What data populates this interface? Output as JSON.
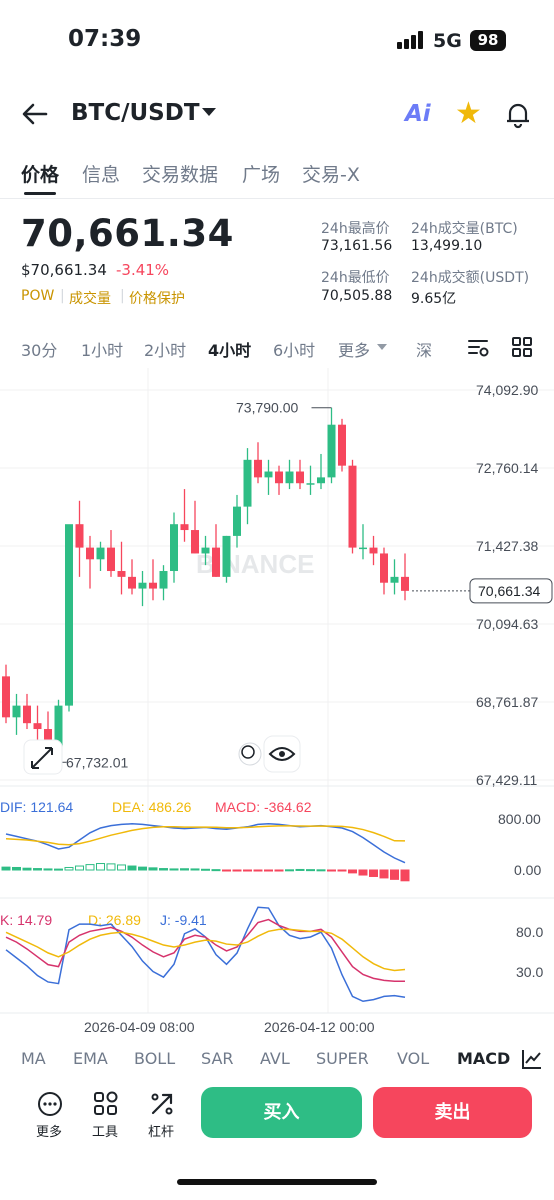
{
  "status_bar": {
    "time": "07:39",
    "network": "5G",
    "battery": "98"
  },
  "header": {
    "pair": "BTC/USDT",
    "ai_label": "Ai"
  },
  "tabs": [
    {
      "label": "价格",
      "active": true
    },
    {
      "label": "信息",
      "active": false
    },
    {
      "label": "交易数据",
      "active": false
    },
    {
      "label": "广场",
      "active": false
    },
    {
      "label": "交易-X",
      "active": false
    }
  ],
  "price": {
    "last": "70,661.34",
    "usd": "$70,661.34",
    "change_pct": "-3.41%",
    "tags": [
      "POW",
      "成交量",
      "价格保护"
    ]
  },
  "stats": {
    "high_label": "24h最高价",
    "high": "73,161.56",
    "vol_btc_label": "24h成交量(BTC)",
    "vol_btc": "13,499.10",
    "low_label": "24h最低价",
    "low": "70,505.88",
    "vol_usdt_label": "24h成交额(USDT)",
    "vol_usdt": "9.65亿"
  },
  "intervals": [
    {
      "label": "30分",
      "active": false
    },
    {
      "label": "1小时",
      "active": false
    },
    {
      "label": "2小时",
      "active": false
    },
    {
      "label": "4小时",
      "active": true
    },
    {
      "label": "6小时",
      "active": false
    },
    {
      "label": "更多",
      "active": false
    },
    {
      "label": "深",
      "active": false
    }
  ],
  "colors": {
    "up": "#2ebd85",
    "down": "#f6465d",
    "accent": "#f0b90b",
    "dif": "#3b6fd8",
    "dea": "#f0b90b",
    "k": "#d6336c",
    "d": "#f0b90b",
    "j": "#3b6fd8"
  },
  "chart_data": {
    "type": "candlestick",
    "price_axis": [
      "74,092.90",
      "72,760.14",
      "71,427.38",
      "70,094.63",
      "68,761.87",
      "67,429.11"
    ],
    "ylim": [
      67429.11,
      74092.9
    ],
    "last_price_label": "70,661.34",
    "high_marker": "73,790.00",
    "low_marker": "67,732.01",
    "time_axis": [
      "2026-04-09 08:00",
      "2026-04-12 00:00"
    ],
    "watermark": "BINANCE",
    "candles": [
      [
        69200,
        69400,
        68400,
        68500
      ],
      [
        68500,
        68900,
        68200,
        68700
      ],
      [
        68700,
        68900,
        68300,
        68400
      ],
      [
        68400,
        68700,
        68100,
        68300
      ],
      [
        68300,
        68600,
        67900,
        68000
      ],
      [
        68000,
        68800,
        67732,
        68700
      ],
      [
        68700,
        71700,
        68600,
        71800
      ],
      [
        71800,
        72200,
        70900,
        71400
      ],
      [
        71400,
        71600,
        70700,
        71200
      ],
      [
        71200,
        71500,
        71000,
        71400
      ],
      [
        71400,
        71700,
        70900,
        71000
      ],
      [
        71000,
        71500,
        70600,
        70900
      ],
      [
        70900,
        71200,
        70600,
        70700
      ],
      [
        70700,
        71000,
        70400,
        70800
      ],
      [
        70800,
        71200,
        70500,
        70700
      ],
      [
        70700,
        71100,
        70500,
        71000
      ],
      [
        71000,
        72000,
        70800,
        71800
      ],
      [
        71800,
        72400,
        71500,
        71700
      ],
      [
        71700,
        72200,
        71300,
        71300
      ],
      [
        71300,
        71600,
        71100,
        71400
      ],
      [
        71400,
        71800,
        70900,
        70900
      ],
      [
        70900,
        71600,
        70800,
        71600
      ],
      [
        71600,
        72300,
        71400,
        72100
      ],
      [
        72100,
        73100,
        71800,
        72900
      ],
      [
        72900,
        73200,
        72500,
        72600
      ],
      [
        72600,
        72900,
        72300,
        72700
      ],
      [
        72700,
        72800,
        72300,
        72500
      ],
      [
        72500,
        72900,
        72400,
        72700
      ],
      [
        72700,
        72900,
        72400,
        72500
      ],
      [
        72500,
        72800,
        72300,
        72500
      ],
      [
        72500,
        73000,
        72400,
        72600
      ],
      [
        72600,
        73790,
        72500,
        73500
      ],
      [
        73500,
        73600,
        72700,
        72800
      ],
      [
        72800,
        72900,
        71300,
        71400
      ],
      [
        71400,
        71800,
        71200,
        71400
      ],
      [
        71400,
        71600,
        71100,
        71300
      ],
      [
        71300,
        71400,
        70600,
        70800
      ],
      [
        70800,
        71200,
        70600,
        70900
      ],
      [
        70900,
        71300,
        70500,
        70661
      ]
    ],
    "macd": {
      "dif": "121.64",
      "dea": "486.26",
      "macd": "-364.62",
      "axis": [
        "800.00",
        "0.00"
      ],
      "hist": [
        80,
        70,
        50,
        40,
        30,
        25,
        70,
        110,
        150,
        180,
        170,
        140,
        110,
        80,
        60,
        40,
        30,
        35,
        30,
        20,
        10,
        -10,
        -15,
        -20,
        -15,
        -10,
        -5,
        5,
        15,
        10,
        5,
        -5,
        -20,
        -80,
        -140,
        -180,
        -220,
        -260,
        -300
      ],
      "dif_line": [
        600,
        560,
        520,
        480,
        420,
        350,
        380,
        500,
        620,
        700,
        740,
        760,
        770,
        760,
        740,
        720,
        700,
        690,
        700,
        710,
        690,
        680,
        700,
        720,
        760,
        770,
        760,
        740,
        720,
        730,
        740,
        720,
        700,
        640,
        540,
        420,
        300,
        200,
        122
      ],
      "dea_line": [
        520,
        510,
        500,
        480,
        460,
        430,
        420,
        440,
        480,
        530,
        580,
        620,
        660,
        690,
        710,
        720,
        720,
        715,
        715,
        715,
        712,
        705,
        705,
        710,
        720,
        730,
        735,
        735,
        733,
        732,
        734,
        732,
        727,
        708,
        674,
        623,
        559,
        487,
        486
      ]
    },
    "kdj": {
      "k": "14.79",
      "d": "26.89",
      "j": "-9.41",
      "axis": [
        "80.0",
        "30.0"
      ],
      "k_line": [
        60,
        55,
        48,
        40,
        32,
        30,
        55,
        62,
        66,
        68,
        70,
        66,
        60,
        52,
        45,
        40,
        44,
        58,
        62,
        60,
        52,
        46,
        50,
        62,
        75,
        78,
        72,
        68,
        66,
        66,
        68,
        60,
        45,
        30,
        22,
        18,
        16,
        15,
        15
      ],
      "d_line": [
        65,
        60,
        55,
        50,
        44,
        40,
        45,
        52,
        58,
        62,
        64,
        65,
        63,
        60,
        56,
        52,
        50,
        52,
        55,
        57,
        56,
        53,
        52,
        55,
        61,
        66,
        68,
        68,
        67,
        66,
        66,
        64,
        58,
        49,
        40,
        33,
        28,
        26,
        27
      ],
      "j_line": [
        50,
        40,
        30,
        18,
        10,
        8,
        75,
        82,
        82,
        80,
        82,
        68,
        54,
        36,
        23,
        16,
        32,
        70,
        76,
        66,
        44,
        32,
        46,
        76,
        103,
        102,
        80,
        68,
        64,
        66,
        72,
        52,
        19,
        -8,
        -14,
        -12,
        -8,
        -7,
        -9
      ]
    }
  },
  "indicators": [
    {
      "label": "MA",
      "active": false
    },
    {
      "label": "EMA",
      "active": false
    },
    {
      "label": "BOLL",
      "active": false
    },
    {
      "label": "SAR",
      "active": false
    },
    {
      "label": "AVL",
      "active": false
    },
    {
      "label": "SUPER",
      "active": false
    },
    {
      "label": "VOL",
      "active": false
    },
    {
      "label": "MACD",
      "active": true
    }
  ],
  "toolbar": {
    "more": "更多",
    "tools": "工具",
    "leverage": "杠杆",
    "buy": "买入",
    "sell": "卖出"
  }
}
